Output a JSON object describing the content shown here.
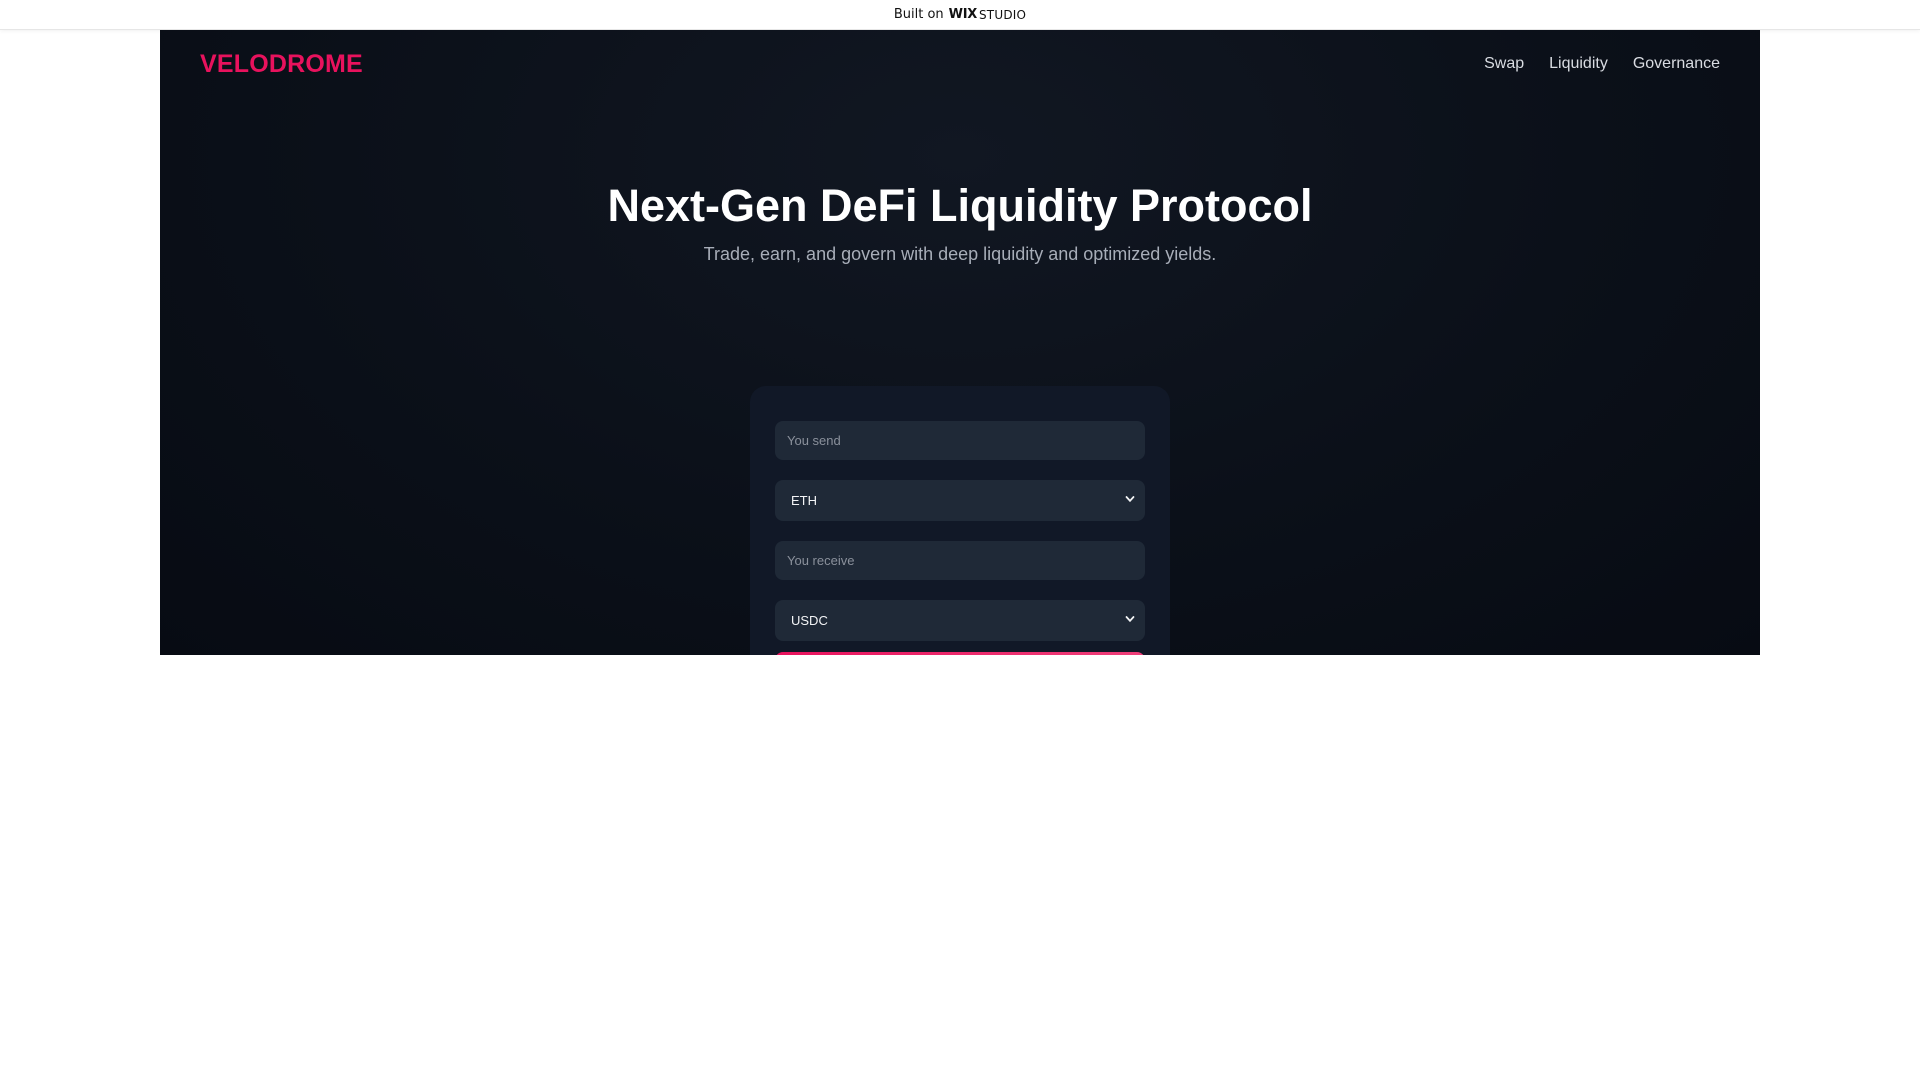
{
  "wix_bar": {
    "prefix": "Built on",
    "brand_bold": "WIX",
    "brand_light": "STUDIO"
  },
  "nav": {
    "logo": "VELODROME",
    "links": [
      "Swap",
      "Liquidity",
      "Governance"
    ]
  },
  "hero": {
    "title": "Next-Gen DeFi Liquidity Protocol",
    "subtitle": "Trade, earn, and govern with deep liquidity and optimized yields."
  },
  "swap": {
    "send_placeholder": "You send",
    "send_token": "ETH",
    "receive_placeholder": "You receive",
    "receive_token": "USDC",
    "icons": {
      "select_arrow": "chevron-down-icon"
    }
  },
  "colors": {
    "accent": "#e8125d",
    "background": "#0b1019",
    "card": "#111827",
    "field": "#1f2937"
  }
}
